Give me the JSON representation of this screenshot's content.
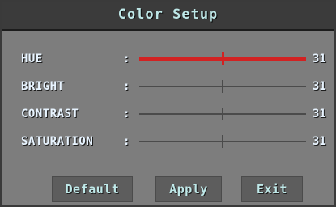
{
  "window": {
    "title": "Color Setup"
  },
  "settings": [
    {
      "label": "HUE",
      "colon": ":",
      "value": "31",
      "level": 0.5,
      "active": true
    },
    {
      "label": "BRIGHT",
      "colon": ":",
      "value": "31",
      "level": 0.5,
      "active": false
    },
    {
      "label": "CONTRAST",
      "colon": ":",
      "value": "31",
      "level": 0.5,
      "active": false
    },
    {
      "label": "SATURATION",
      "colon": ":",
      "value": "31",
      "level": 0.5,
      "active": false
    }
  ],
  "buttons": {
    "default_label": "Default",
    "apply_label": "Apply",
    "exit_label": "Exit"
  },
  "colors": {
    "active_slider": "#d22222",
    "inactive_slider": "#4b4b4b",
    "title_text": "#bfe8e8",
    "label_text": "#e8f4ff"
  }
}
